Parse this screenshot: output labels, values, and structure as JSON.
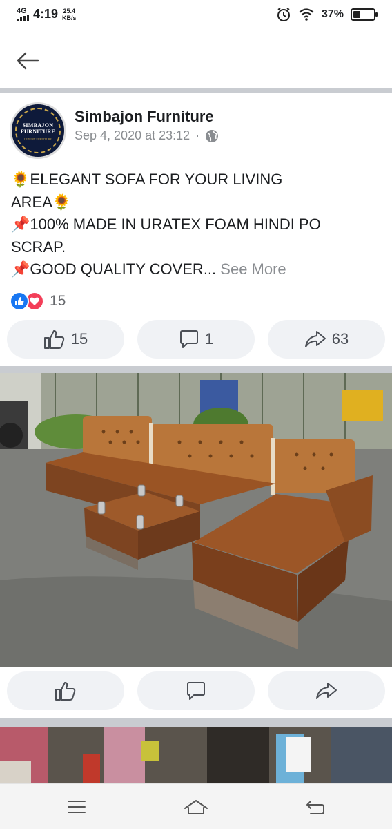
{
  "status_bar": {
    "network": "4G",
    "time": "4:19",
    "speed_value": "25.4",
    "speed_unit": "KB/s",
    "battery_percent": "37%",
    "battery_level": 0.37
  },
  "post": {
    "page_name": "Simbajon Furniture",
    "date": "Sep 4, 2020 at 23:12",
    "separator": "·",
    "avatar_text_line1": "SIMBAJON",
    "avatar_text_line2": "FURNITURE",
    "avatar_text_line3": "LUXURY FURNITURE",
    "text_lines": [
      "🌻ELEGANT SOFA FOR YOUR LIVING",
      "AREA🌻",
      "📌100% MADE IN URATEX FOAM HINDI PO",
      "SCRAP.",
      "📌GOOD QUALITY COVER..."
    ],
    "see_more": "See More",
    "reaction_count": "15"
  },
  "actions_top": {
    "like_count": "15",
    "comment_count": "1",
    "share_count": "63"
  },
  "icons": {
    "back": "arrow-left-icon",
    "alarm": "alarm-icon",
    "wifi": "wifi-icon",
    "globe": "globe-icon",
    "like": "thumbs-up-icon",
    "comment": "comment-icon",
    "share": "share-icon",
    "menu": "menu-icon",
    "home": "home-icon",
    "back_nav": "back-nav-icon"
  },
  "colors": {
    "like_blue": "#1877f2",
    "love_red": "#f33e58",
    "muted_text": "#8a8d91",
    "button_bg": "#f0f2f5"
  }
}
